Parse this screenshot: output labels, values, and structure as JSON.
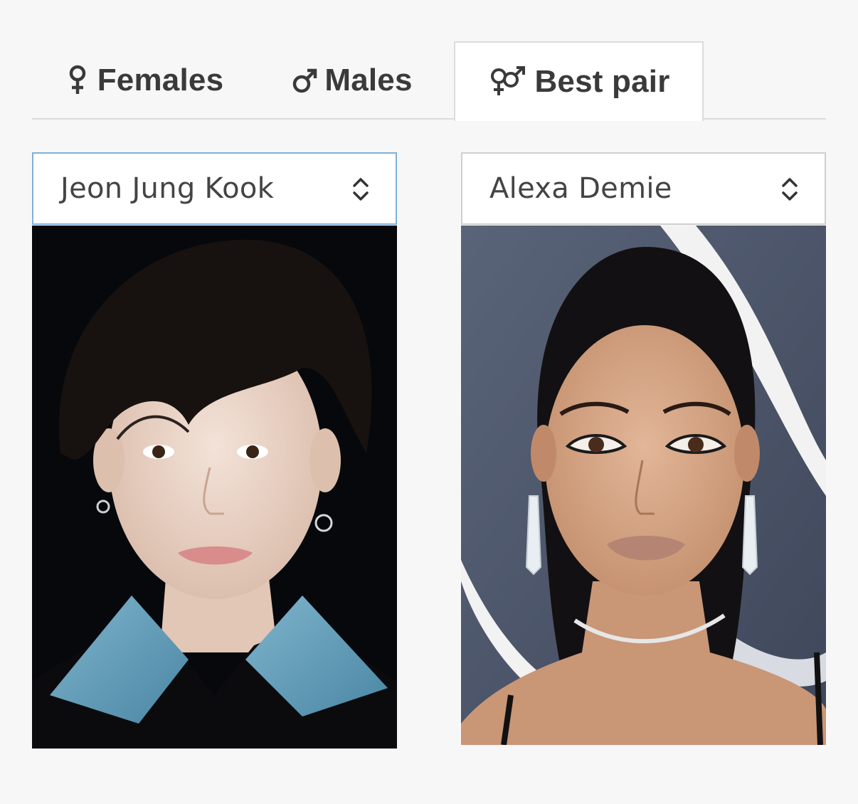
{
  "tabs": {
    "females": {
      "label": "Females",
      "icon": "female-sign-icon"
    },
    "males": {
      "label": "Males",
      "icon": "male-sign-icon"
    },
    "best_pair": {
      "label": "Best pair",
      "icon": "gender-pair-icon",
      "active": true
    }
  },
  "pair": {
    "left": {
      "selected": "Jeon Jung Kook",
      "photo_alt": "Jeon Jung Kook"
    },
    "right": {
      "selected": "Alexa Demie",
      "photo_alt": "Alexa Demie"
    }
  },
  "colors": {
    "background": "#f7f7f7",
    "tab_text": "#3a3a3a",
    "border": "#dcdcdc",
    "focus_border": "#80b0d8"
  }
}
